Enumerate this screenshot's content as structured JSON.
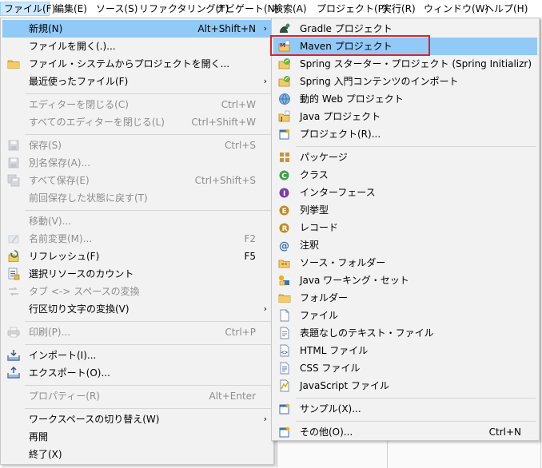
{
  "menubar": {
    "items": [
      "ファイル(F)",
      "編集(E)",
      "ソース(S)",
      "リファクタリング(T)",
      "ナビゲート(N)",
      "検索(A)",
      "プロジェクト(P)",
      "実行(R)",
      "ウィンドウ(W)",
      "ヘルプ(H)"
    ]
  },
  "file_menu": {
    "new": {
      "label": "新規(N)",
      "shortcut": "Alt+Shift+N"
    },
    "open_file": {
      "label": "ファイルを開く(.)..."
    },
    "open_project": {
      "label": "ファイル・システムからプロジェクトを開く..."
    },
    "recent": {
      "label": "最近使ったファイル(F)"
    },
    "close_editor": {
      "label": "エディターを閉じる(C)",
      "shortcut": "Ctrl+W"
    },
    "close_all": {
      "label": "すべてのエディターを閉じる(L)",
      "shortcut": "Ctrl+Shift+W"
    },
    "save": {
      "label": "保存(S)",
      "shortcut": "Ctrl+S"
    },
    "save_as": {
      "label": "別名保存(A)..."
    },
    "save_all": {
      "label": "すべて保存(E)",
      "shortcut": "Ctrl+Shift+S"
    },
    "revert": {
      "label": "前回保存した状態に戻す(T)"
    },
    "move": {
      "label": "移動(V)..."
    },
    "rename": {
      "label": "名前変更(M)...",
      "shortcut": "F2"
    },
    "refresh": {
      "label": "リフレッシュ(F)",
      "shortcut": "F5"
    },
    "select_resources": {
      "label": "選択リソースのカウント"
    },
    "convert_tabs": {
      "label": "タブ <-> スペースの変換"
    },
    "line_delimiters": {
      "label": "行区切り文字の変換(V)"
    },
    "print": {
      "label": "印刷(P)...",
      "shortcut": "Ctrl+P"
    },
    "import": {
      "label": "インポート(I)..."
    },
    "export": {
      "label": "エクスポート(O)..."
    },
    "properties": {
      "label": "プロパティー(R)",
      "shortcut": "Alt+Enter"
    },
    "switch_workspace": {
      "label": "ワークスペースの切り替え(W)"
    },
    "restart": {
      "label": "再開"
    },
    "exit": {
      "label": "終了(X)"
    }
  },
  "new_menu": {
    "gradle": {
      "label": "Gradle プロジェクト"
    },
    "maven": {
      "label": "Maven プロジェクト"
    },
    "spring_starter": {
      "label": "Spring スターター・プロジェクト (Spring Initializr)"
    },
    "spring_import": {
      "label": "Spring 入門コンテンツのインポート"
    },
    "dynamic_web": {
      "label": "動的 Web プロジェクト"
    },
    "java_project": {
      "label": "Java プロジェクト"
    },
    "project": {
      "label": "プロジェクト(R)..."
    },
    "package": {
      "label": "パッケージ"
    },
    "class": {
      "label": "クラス"
    },
    "interface": {
      "label": "インターフェース"
    },
    "enum": {
      "label": "列挙型"
    },
    "record": {
      "label": "レコード"
    },
    "annotation": {
      "label": "注釈"
    },
    "source_folder": {
      "label": "ソース・フォルダー"
    },
    "working_set": {
      "label": "Java ワーキング・セット"
    },
    "folder": {
      "label": "フォルダー"
    },
    "file": {
      "label": "ファイル"
    },
    "untitled_text": {
      "label": "表題なしのテキスト・ファイル"
    },
    "html_file": {
      "label": "HTML ファイル"
    },
    "css_file": {
      "label": "CSS ファイル"
    },
    "js_file": {
      "label": "JavaScript ファイル"
    },
    "example": {
      "label": "サンプル(X)..."
    },
    "other": {
      "label": "その他(O)...",
      "shortcut": "Ctrl+N"
    }
  },
  "colors": {
    "highlight": "#91c9f7",
    "menu_bg": "#f2f2f2",
    "annotation_box": "#e0202a"
  }
}
